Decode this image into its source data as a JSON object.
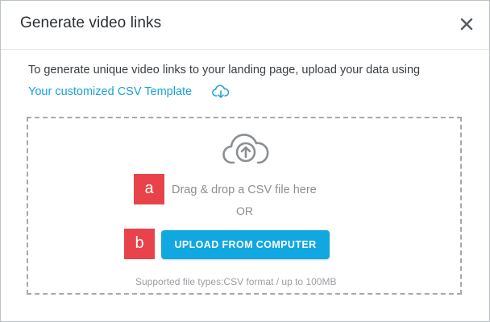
{
  "dialog": {
    "title": "Generate video links",
    "close_icon": "close-icon"
  },
  "intro": {
    "text": "To generate unique video links to your landing page, upload your data using",
    "template_link": "Your customized CSV Template",
    "download_icon": "cloud-download-icon"
  },
  "dropzone": {
    "upload_icon": "cloud-upload-icon",
    "drag_text": "Drag & drop a CSV file here",
    "or_text": "OR",
    "upload_button": "UPLOAD FROM COMPUTER",
    "supported_text": "Supported file types:CSV format / up to 100MB"
  },
  "annotations": {
    "badge_a": "a",
    "badge_b": "b"
  },
  "colors": {
    "accent": "#11a7e1",
    "link": "#1aa0d8",
    "badge": "#e8434a",
    "muted_text": "#8a8f94"
  }
}
